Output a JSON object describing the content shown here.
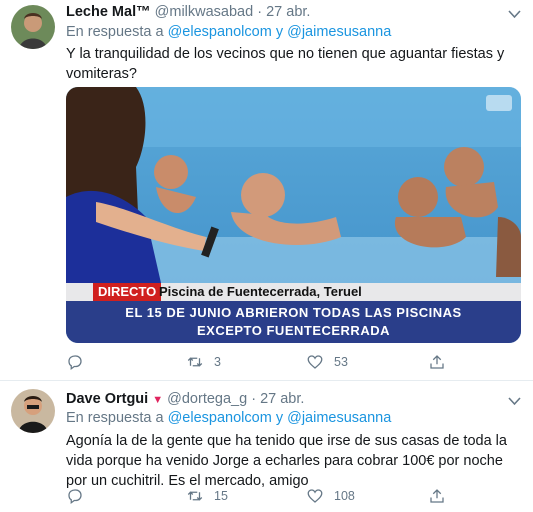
{
  "tweets": [
    {
      "display_name": "Leche Mal™",
      "handle": "@milkwasabad",
      "separator": "·",
      "date": "27 abr.",
      "reply_prefix": "En respuesta a",
      "reply_user_1": "@elespanolcom",
      "reply_join": "y",
      "reply_user_2": "@jaimesusanna",
      "text": "Y la tranquilidad de los vecinos que no tienen que aguantar fiestas y vomiteras?",
      "media": {
        "live_badge": "DIRECTO",
        "location": "Piscina de Fuentecerrada, Teruel",
        "headline_1": "EL 15 DE JUNIO ABRIERON TODAS LAS PISCINAS",
        "headline_2": "EXCEPTO FUENTECERRADA"
      },
      "replies": "",
      "retweets": "3",
      "likes": "53"
    },
    {
      "display_name": "Dave Ortgui",
      "handle": "@dortega_g",
      "separator": "·",
      "date": "27 abr.",
      "reply_prefix": "En respuesta a",
      "reply_user_1": "@elespanolcom",
      "reply_join": "y",
      "reply_user_2": "@jaimesusanna",
      "text": "Agonía la de la gente que ha tenido que irse de sus casas de toda la vida porque ha venido Jorge a echarles para cobrar 100€ por noche por un cuchitril. Es el mercado, amigo",
      "replies": "",
      "retweets": "15",
      "likes": "108"
    }
  ],
  "colors": {
    "link": "#1b95e0",
    "muted": "#657786",
    "text": "#14171a",
    "heart": "#e0245e",
    "live": "#d0201f",
    "ticker": "#2a3e8a"
  }
}
